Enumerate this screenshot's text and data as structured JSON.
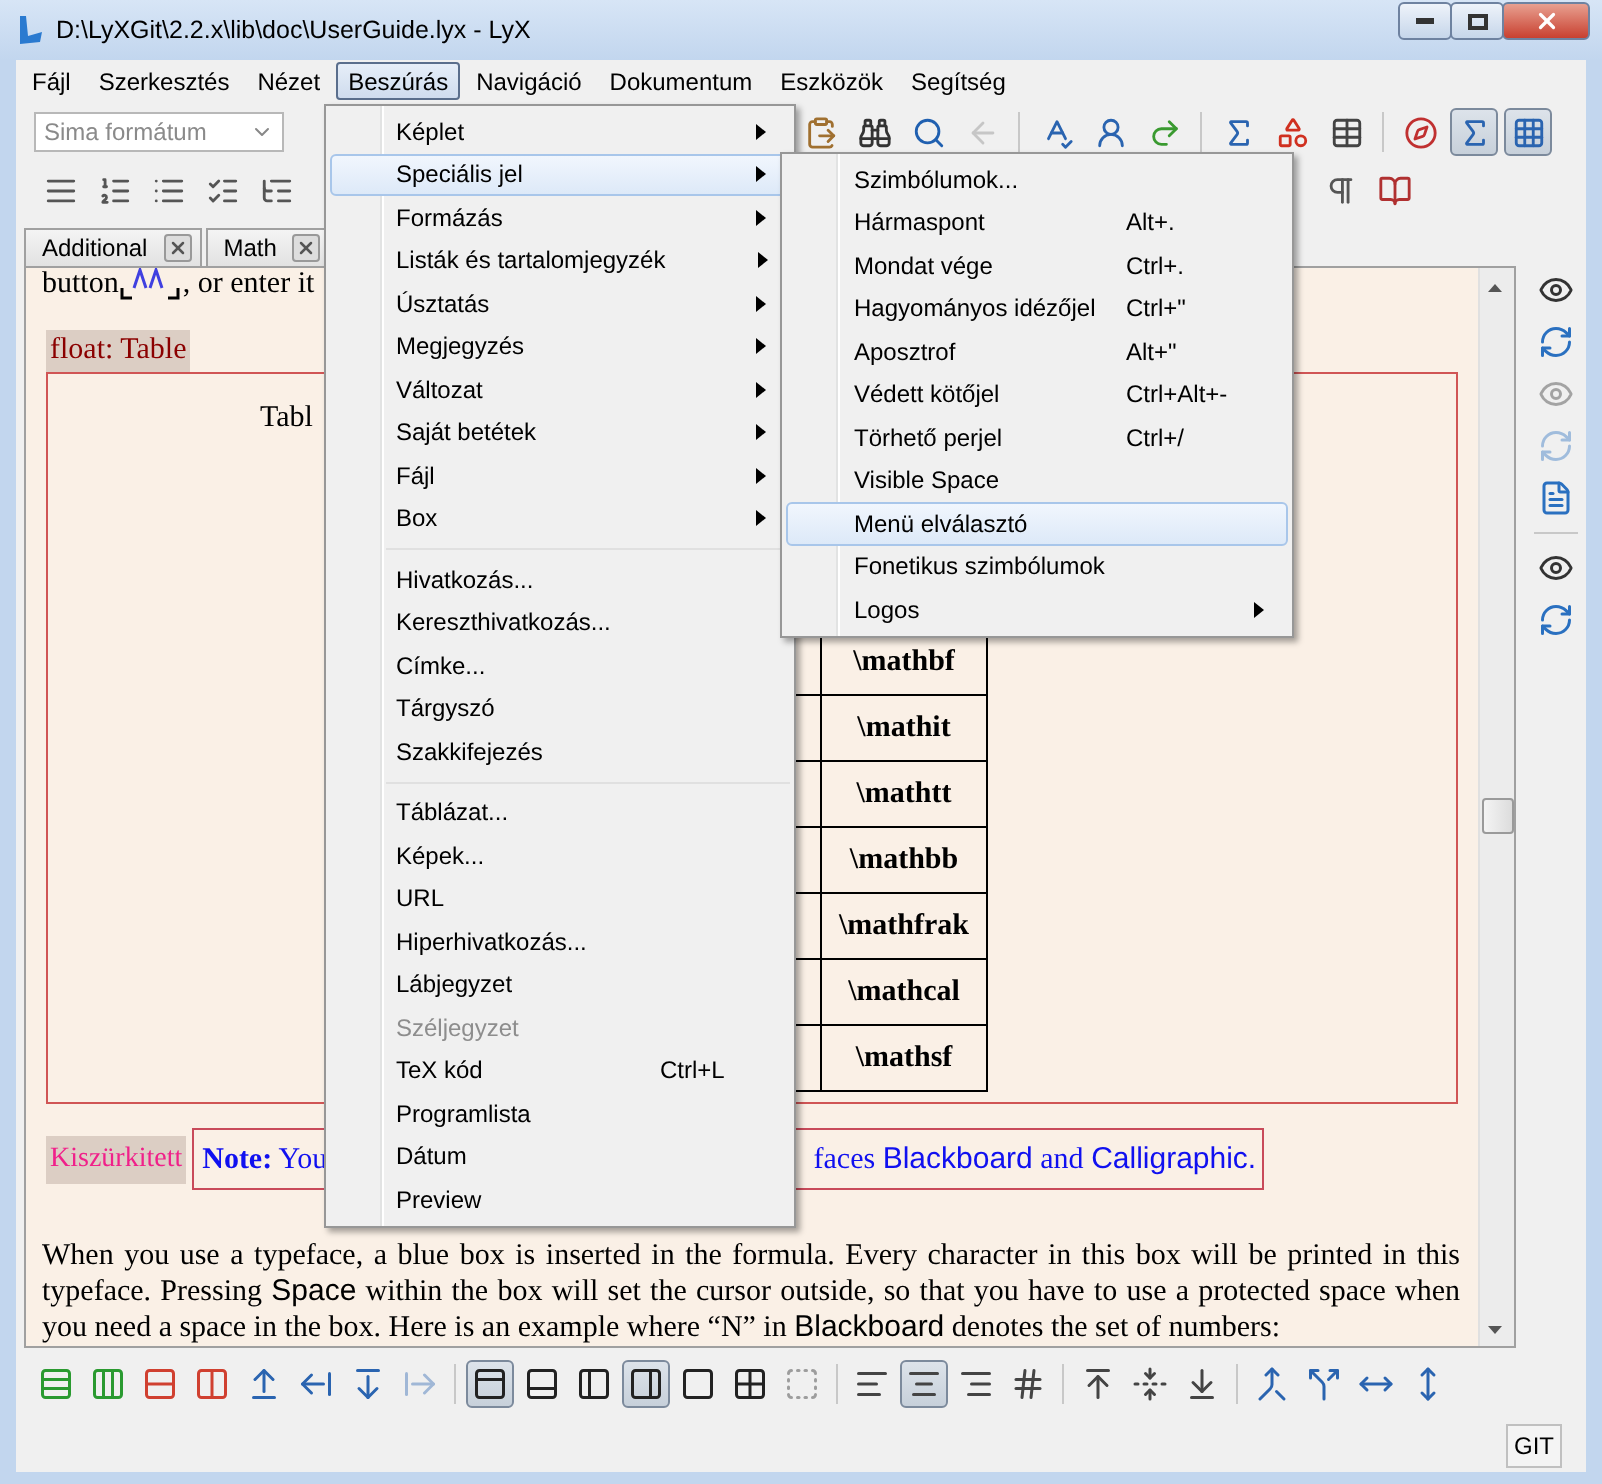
{
  "window": {
    "title": "D:\\LyXGit\\2.2.x\\lib\\doc\\UserGuide.lyx - LyX"
  },
  "menubar": [
    {
      "label": "Fájl",
      "selected": false
    },
    {
      "label": "Szerkesztés",
      "selected": false
    },
    {
      "label": "Nézet",
      "selected": false
    },
    {
      "label": "Beszúrás",
      "selected": true
    },
    {
      "label": "Navigáció",
      "selected": false
    },
    {
      "label": "Dokumentum",
      "selected": false
    },
    {
      "label": "Eszközök",
      "selected": false
    },
    {
      "label": "Segítség",
      "selected": false
    }
  ],
  "paragraph_style": {
    "value": "Sima formátum",
    "disabled": true
  },
  "toolbar_main": [
    {
      "kind": "paste",
      "pressed": false,
      "disabled": false
    },
    {
      "kind": "find",
      "pressed": false,
      "disabled": false
    },
    {
      "kind": "search",
      "pressed": false,
      "disabled": false
    },
    {
      "kind": "back",
      "pressed": false,
      "disabled": true
    },
    {
      "kind": "separator"
    },
    {
      "kind": "spellcheck",
      "pressed": false,
      "disabled": false
    },
    {
      "kind": "thesaurus",
      "pressed": false,
      "disabled": false
    },
    {
      "kind": "change",
      "pressed": false,
      "disabled": false
    },
    {
      "kind": "separator"
    },
    {
      "kind": "math",
      "pressed": false,
      "disabled": false
    },
    {
      "kind": "shapes",
      "pressed": false,
      "disabled": false
    },
    {
      "kind": "table",
      "pressed": false,
      "disabled": false
    },
    {
      "kind": "separator"
    },
    {
      "kind": "compass",
      "pressed": false,
      "disabled": false
    },
    {
      "kind": "math-panel",
      "pressed": true,
      "disabled": false
    },
    {
      "kind": "matrix-panel",
      "pressed": true,
      "disabled": false
    }
  ],
  "toolbar_layout_left": [
    {
      "kind": "justify",
      "pressed": false,
      "disabled": false
    },
    {
      "kind": "numbered",
      "pressed": false,
      "disabled": false
    },
    {
      "kind": "bulleted",
      "pressed": false,
      "disabled": false
    },
    {
      "kind": "checklist",
      "pressed": false,
      "disabled": false
    },
    {
      "kind": "outline",
      "pressed": false,
      "disabled": false
    }
  ],
  "toolbar_layout_right": [
    {
      "kind": "pilcrow",
      "pressed": false,
      "disabled": false
    },
    {
      "kind": "book",
      "pressed": false,
      "disabled": false
    }
  ],
  "tabs": [
    {
      "label": "Additional",
      "selected": false
    },
    {
      "label": "Math",
      "selected": false
    }
  ],
  "document": {
    "intro_before": "button",
    "intro_after": ", or enter it",
    "float_label": "float: Table",
    "caption": "Tabl",
    "table_rows": [
      "\\mathbf",
      "\\mathit",
      "\\mathtt",
      "\\mathbb",
      "\\mathfrak",
      "\\mathcal",
      "\\mathsf"
    ],
    "branch_label": "Kiszürkitett",
    "note_start": "**Note:** You",
    "note_end": [
      {
        "kind": "serif",
        "text": "faces "
      },
      {
        "kind": "sans",
        "text": "Blackboard"
      },
      {
        "kind": "serif",
        "text": " and "
      },
      {
        "kind": "sans",
        "text": "Calligraphic."
      }
    ],
    "paragraph": [
      {
        "kind": "serif",
        "text": "When you use a typeface, a blue box is inserted in the formula. Every character in this box will be printed in this typeface. Pressing "
      },
      {
        "kind": "sans",
        "text": "Space"
      },
      {
        "kind": "serif",
        "text": " within the box will set the cursor outside, so that you have to use a protected space when you need a space in the box. Here is an example where “N” in "
      },
      {
        "kind": "sans",
        "text": "Blackboard"
      },
      {
        "kind": "serif",
        "text": " denotes the set of numbers:"
      }
    ]
  },
  "side_toolbar": [
    {
      "kind": "view",
      "disabled": false
    },
    {
      "kind": "update",
      "disabled": false
    },
    {
      "kind": "view",
      "disabled": true
    },
    {
      "kind": "update",
      "disabled": true
    },
    {
      "kind": "file",
      "disabled": false
    },
    {
      "kind": "separator"
    },
    {
      "kind": "view",
      "disabled": false
    },
    {
      "kind": "update",
      "disabled": false
    }
  ],
  "table_toolbar": [
    {
      "kind": "add-row",
      "pressed": false,
      "disabled": false
    },
    {
      "kind": "add-column",
      "pressed": false,
      "disabled": false
    },
    {
      "kind": "delete-row",
      "pressed": false,
      "disabled": false
    },
    {
      "kind": "delete-column",
      "pressed": false,
      "disabled": false
    },
    {
      "kind": "move-up",
      "pressed": false,
      "disabled": false
    },
    {
      "kind": "move-left",
      "pressed": false,
      "disabled": false
    },
    {
      "kind": "move-down",
      "pressed": false,
      "disabled": false
    },
    {
      "kind": "move-right",
      "pressed": false,
      "disabled": true
    },
    {
      "kind": "separator"
    },
    {
      "kind": "border-top",
      "pressed": true,
      "disabled": false
    },
    {
      "kind": "border-bottom",
      "pressed": false,
      "disabled": false
    },
    {
      "kind": "border-left",
      "pressed": false,
      "disabled": false
    },
    {
      "kind": "border-right",
      "pressed": true,
      "disabled": false
    },
    {
      "kind": "border-all",
      "pressed": false,
      "disabled": false
    },
    {
      "kind": "border-grid",
      "pressed": false,
      "disabled": false
    },
    {
      "kind": "border-none",
      "pressed": false,
      "disabled": true
    },
    {
      "kind": "separator"
    },
    {
      "kind": "align-left",
      "pressed": false,
      "disabled": false
    },
    {
      "kind": "align-center",
      "pressed": true,
      "disabled": false
    },
    {
      "kind": "align-right",
      "pressed": false,
      "disabled": false
    },
    {
      "kind": "align-decimal",
      "pressed": false,
      "disabled": false
    },
    {
      "kind": "separator"
    },
    {
      "kind": "valign-top",
      "pressed": false,
      "disabled": false
    },
    {
      "kind": "valign-middle",
      "pressed": false,
      "disabled": false
    },
    {
      "kind": "valign-bottom",
      "pressed": false,
      "disabled": false
    },
    {
      "kind": "separator"
    },
    {
      "kind": "merge",
      "pressed": false,
      "disabled": false
    },
    {
      "kind": "split",
      "pressed": false,
      "disabled": false
    },
    {
      "kind": "resize-horizontal",
      "pressed": false,
      "disabled": false
    },
    {
      "kind": "resize-vertical",
      "pressed": false,
      "disabled": false
    }
  ],
  "status_bar": {
    "badge": "GIT"
  },
  "insert_menu": {
    "items": [
      {
        "kind": "item",
        "label": "Képlet",
        "submenu": true,
        "selected": false,
        "disabled": false
      },
      {
        "kind": "item",
        "label": "Speciális jel",
        "submenu": true,
        "selected": true,
        "disabled": false
      },
      {
        "kind": "item",
        "label": "Formázás",
        "submenu": true,
        "selected": false,
        "disabled": false
      },
      {
        "kind": "item",
        "label": "Listák és tartalomjegyzék",
        "submenu": true,
        "selected": false,
        "disabled": false
      },
      {
        "kind": "item",
        "label": "Úsztatás",
        "submenu": true,
        "selected": false,
        "disabled": false
      },
      {
        "kind": "item",
        "label": "Megjegyzés",
        "submenu": true,
        "selected": false,
        "disabled": false
      },
      {
        "kind": "item",
        "label": "Változat",
        "submenu": true,
        "selected": false,
        "disabled": false
      },
      {
        "kind": "item",
        "label": "Saját betétek",
        "submenu": true,
        "selected": false,
        "disabled": false
      },
      {
        "kind": "item",
        "label": "Fájl",
        "submenu": true,
        "selected": false,
        "disabled": false
      },
      {
        "kind": "item",
        "label": "Box",
        "submenu": true,
        "selected": false,
        "disabled": false
      },
      {
        "kind": "separator"
      },
      {
        "kind": "item",
        "label": "Hivatkozás...",
        "submenu": false,
        "selected": false,
        "disabled": false
      },
      {
        "kind": "item",
        "label": "Kereszthivatkozás...",
        "submenu": false,
        "selected": false,
        "disabled": false
      },
      {
        "kind": "item",
        "label": "Címke...",
        "submenu": false,
        "selected": false,
        "disabled": false
      },
      {
        "kind": "item",
        "label": "Tárgyszó",
        "submenu": false,
        "selected": false,
        "disabled": false
      },
      {
        "kind": "item",
        "label": "Szakkifejezés",
        "submenu": false,
        "selected": false,
        "disabled": false
      },
      {
        "kind": "separator"
      },
      {
        "kind": "item",
        "label": "Táblázat...",
        "submenu": false,
        "selected": false,
        "disabled": false
      },
      {
        "kind": "item",
        "label": "Képek...",
        "submenu": false,
        "selected": false,
        "disabled": false
      },
      {
        "kind": "item",
        "label": "URL",
        "submenu": false,
        "selected": false,
        "disabled": false
      },
      {
        "kind": "item",
        "label": "Hiperhivatkozás...",
        "submenu": false,
        "selected": false,
        "disabled": false
      },
      {
        "kind": "item",
        "label": "Lábjegyzet",
        "submenu": false,
        "selected": false,
        "disabled": false
      },
      {
        "kind": "item",
        "label": "Széljegyzet",
        "submenu": false,
        "selected": false,
        "disabled": true
      },
      {
        "kind": "item",
        "label": "TeX kód",
        "shortcut": "Ctrl+L",
        "submenu": false,
        "selected": false,
        "disabled": false
      },
      {
        "kind": "item",
        "label": "Programlista",
        "submenu": false,
        "selected": false,
        "disabled": false
      },
      {
        "kind": "item",
        "label": "Dátum",
        "submenu": false,
        "selected": false,
        "disabled": false
      },
      {
        "kind": "item",
        "label": "Preview",
        "submenu": false,
        "selected": false,
        "disabled": false
      }
    ]
  },
  "special_char_menu": {
    "items": [
      {
        "kind": "item",
        "label": "Szimbólumok...",
        "submenu": false,
        "selected": false,
        "disabled": false
      },
      {
        "kind": "item",
        "label": "Hármaspont",
        "shortcut": "Alt+.",
        "submenu": false,
        "selected": false,
        "disabled": false
      },
      {
        "kind": "item",
        "label": "Mondat vége",
        "shortcut": "Ctrl+.",
        "submenu": false,
        "selected": false,
        "disabled": false
      },
      {
        "kind": "item",
        "label": "Hagyományos idézőjel",
        "shortcut": "Ctrl+\"",
        "submenu": false,
        "selected": false,
        "disabled": false
      },
      {
        "kind": "item",
        "label": "Aposztrof",
        "shortcut": "Alt+\"",
        "submenu": false,
        "selected": false,
        "disabled": false
      },
      {
        "kind": "item",
        "label": "Védett kötőjel",
        "shortcut": "Ctrl+Alt+-",
        "submenu": false,
        "selected": false,
        "disabled": false
      },
      {
        "kind": "item",
        "label": "Törhető perjel",
        "shortcut": "Ctrl+/",
        "submenu": false,
        "selected": false,
        "disabled": false
      },
      {
        "kind": "item",
        "label": "Visible Space",
        "submenu": false,
        "selected": false,
        "disabled": false
      },
      {
        "kind": "item",
        "label": "Menü elválasztó",
        "submenu": false,
        "selected": true,
        "disabled": false
      },
      {
        "kind": "item",
        "label": "Fonetikus szimbólumok",
        "submenu": false,
        "selected": false,
        "disabled": false
      },
      {
        "kind": "item",
        "label": "Logos",
        "submenu": true,
        "selected": false,
        "disabled": false
      }
    ]
  }
}
